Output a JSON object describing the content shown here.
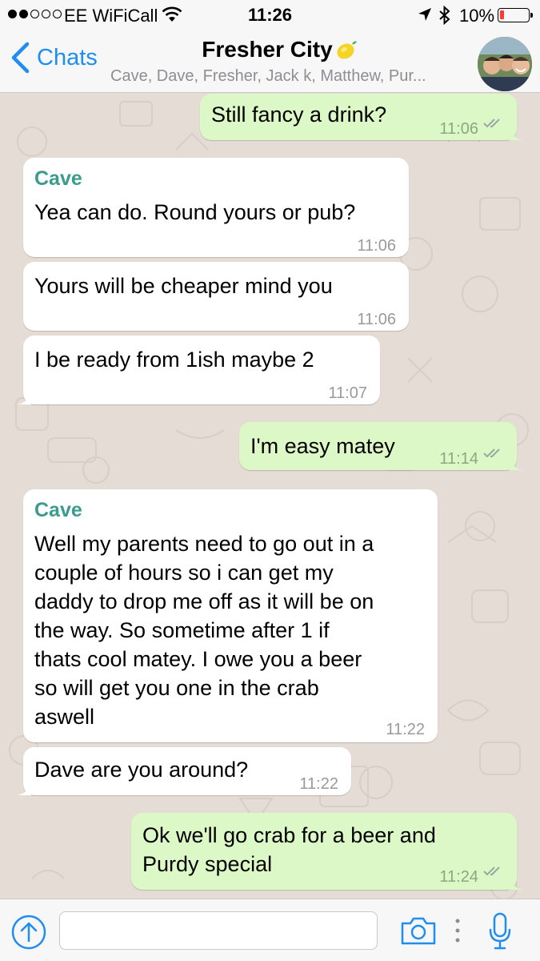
{
  "status_bar": {
    "carrier": "EE WiFiCall",
    "time": "11:26",
    "battery": "10%",
    "signal_bars_filled": 2,
    "signal_bars_total": 5,
    "battery_level_fraction": 0.1
  },
  "header": {
    "back_label": "Chats",
    "title": "Fresher City",
    "members": "Cave, Dave, Fresher, Jack k, Matthew, Pur..."
  },
  "messages": [
    {
      "direction": "out",
      "text_lines": [
        "Still fancy a drink?"
      ],
      "time": "11:06",
      "read": true
    },
    {
      "direction": "in",
      "sender": "Cave",
      "text_lines": [
        "Yea can do. Round yours or pub?"
      ],
      "time": "11:06"
    },
    {
      "direction": "in",
      "text_lines": [
        "Yours will be cheaper mind you"
      ],
      "time": "11:06"
    },
    {
      "direction": "in",
      "text_lines": [
        "I be ready from 1ish maybe 2"
      ],
      "time": "11:07"
    },
    {
      "direction": "out",
      "text_lines": [
        "I'm easy matey"
      ],
      "time": "11:14",
      "read": true
    },
    {
      "direction": "in",
      "sender": "Cave",
      "text_lines": [
        "Well my parents need to go out in a",
        "couple of hours so i can get my",
        "daddy to drop me off as it will be on",
        "the way. So sometime after 1 if",
        "thats cool matey. I owe you a beer",
        "so will get you one in the crab",
        "aswell"
      ],
      "time": "11:22"
    },
    {
      "direction": "in",
      "text_lines": [
        "Dave are you around?"
      ],
      "time": "11:22"
    },
    {
      "direction": "out",
      "text_lines": [
        "Ok we'll go crab for a beer and",
        "Purdy special"
      ],
      "time": "11:24",
      "read": true
    }
  ],
  "input": {
    "value": "",
    "placeholder": ""
  },
  "colors": {
    "accent": "#1f8ef1",
    "outgoing_bubble": "#dcf8c6",
    "incoming_bubble": "#ffffff",
    "sender_name": "#3a9c8c",
    "chat_background": "#e5ddd5"
  },
  "icons": {
    "back": "chevron-left-icon",
    "title_emoji": "lemon-icon",
    "upload": "upload-arrow-icon",
    "camera": "camera-icon",
    "more": "vertical-dots-icon",
    "mic": "microphone-icon",
    "read_receipt": "double-check-icon"
  }
}
